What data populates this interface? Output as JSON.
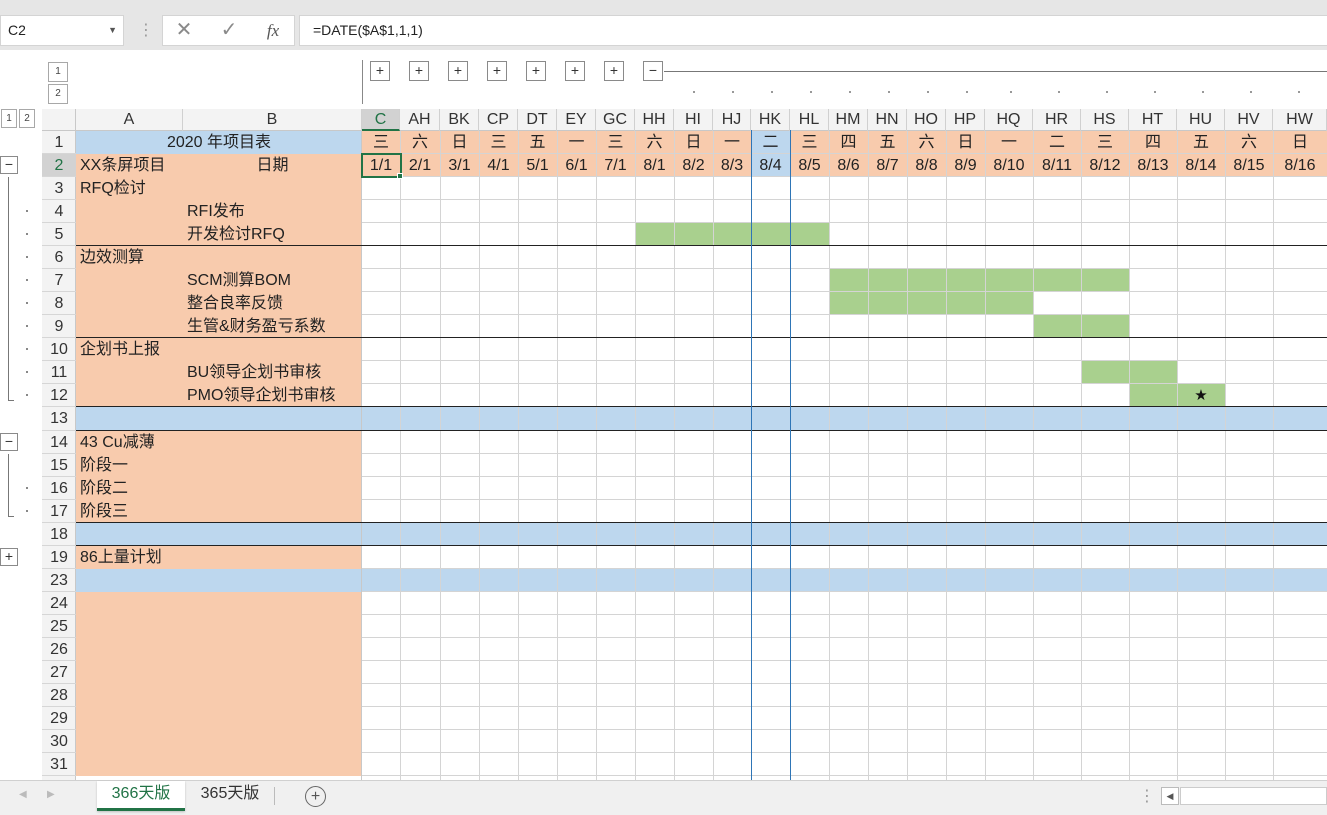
{
  "formula_bar": {
    "name_box": "C2",
    "formula": "=DATE($A$1,1,1)",
    "cancel_icon": "✕",
    "enter_icon": "✓",
    "fx_icon": "fx"
  },
  "outline": {
    "row_levels": [
      "1",
      "2"
    ],
    "col_levels": [
      "1",
      "2"
    ],
    "col_expand_label": "+",
    "col_collapse_label": "−",
    "row_collapse_label": "−",
    "row_expand_label": "+"
  },
  "columns": [
    "C",
    "AH",
    "BK",
    "CP",
    "DT",
    "EY",
    "GC",
    "HH",
    "HI",
    "HJ",
    "HK",
    "HL",
    "HM",
    "HN",
    "HO",
    "HP",
    "HQ",
    "HR",
    "HS",
    "HT",
    "HU",
    "HV",
    "HW"
  ],
  "weekdays": [
    "三",
    "六",
    "日",
    "三",
    "五",
    "一",
    "三",
    "六",
    "日",
    "一",
    "二",
    "三",
    "四",
    "五",
    "六",
    "日",
    "一",
    "二",
    "三",
    "四",
    "五",
    "六",
    "日"
  ],
  "dates": [
    "1/1",
    "2/1",
    "3/1",
    "4/1",
    "5/1",
    "6/1",
    "7/1",
    "8/1",
    "8/2",
    "8/3",
    "8/4",
    "8/5",
    "8/6",
    "8/7",
    "8/8",
    "8/9",
    "8/10",
    "8/11",
    "8/12",
    "8/13",
    "8/14",
    "8/15",
    "8/16"
  ],
  "col_a_label": "A",
  "col_b_label": "B",
  "rows": [
    {
      "num": "1",
      "a": "2020 年项目表",
      "b": ""
    },
    {
      "num": "2",
      "a": "XX条屏项目",
      "b": "日期"
    },
    {
      "num": "3",
      "a": "RFQ检讨",
      "b": ""
    },
    {
      "num": "4",
      "a": "",
      "b": "RFI发布"
    },
    {
      "num": "5",
      "a": "",
      "b": "开发检讨RFQ"
    },
    {
      "num": "6",
      "a": "边效测算",
      "b": ""
    },
    {
      "num": "7",
      "a": "",
      "b": "SCM测算BOM"
    },
    {
      "num": "8",
      "a": "",
      "b": "整合良率反馈"
    },
    {
      "num": "9",
      "a": "",
      "b": "生管&财务盈亏系数"
    },
    {
      "num": "10",
      "a": "企划书上报",
      "b": ""
    },
    {
      "num": "11",
      "a": "",
      "b": "BU领导企划书审核"
    },
    {
      "num": "12",
      "a": "",
      "b": "PMO领导企划书审核"
    },
    {
      "num": "13",
      "a": "",
      "b": ""
    },
    {
      "num": "14",
      "a": "43 Cu减薄",
      "b": ""
    },
    {
      "num": "15",
      "a": "阶段一",
      "b": ""
    },
    {
      "num": "16",
      "a": "阶段二",
      "b": ""
    },
    {
      "num": "17",
      "a": "阶段三",
      "b": ""
    },
    {
      "num": "18",
      "a": "",
      "b": ""
    },
    {
      "num": "19",
      "a": "86上量计划",
      "b": ""
    },
    {
      "num": "23",
      "a": "",
      "b": ""
    },
    {
      "num": "24",
      "a": "",
      "b": ""
    },
    {
      "num": "25",
      "a": "",
      "b": ""
    },
    {
      "num": "26",
      "a": "",
      "b": ""
    },
    {
      "num": "27",
      "a": "",
      "b": ""
    },
    {
      "num": "28",
      "a": "",
      "b": ""
    },
    {
      "num": "29",
      "a": "",
      "b": ""
    },
    {
      "num": "30",
      "a": "",
      "b": ""
    },
    {
      "num": "31",
      "a": "",
      "b": ""
    }
  ],
  "gantt_bars": [
    {
      "row": "5",
      "from": "HH",
      "to": "HL"
    },
    {
      "row": "7",
      "from": "HM",
      "to": "HS"
    },
    {
      "row": "8",
      "from": "HM",
      "to": "HQ"
    },
    {
      "row": "9",
      "from": "HR",
      "to": "HS"
    },
    {
      "row": "11",
      "from": "HS",
      "to": "HT"
    },
    {
      "row": "12",
      "from": "HT",
      "to": "HU"
    }
  ],
  "milestone": {
    "row": "12",
    "col": "HU",
    "symbol": "★"
  },
  "tabs": [
    {
      "label": "366天版",
      "active": true
    },
    {
      "label": "365天版",
      "active": false
    }
  ],
  "add_sheet_icon": "+",
  "colors": {
    "orange": "#f8cbad",
    "blue": "#bdd7ee",
    "green": "#a9d08e",
    "grid": "#d4d4d4",
    "today_line": "#2e75b6",
    "active_tab": "#217346"
  }
}
